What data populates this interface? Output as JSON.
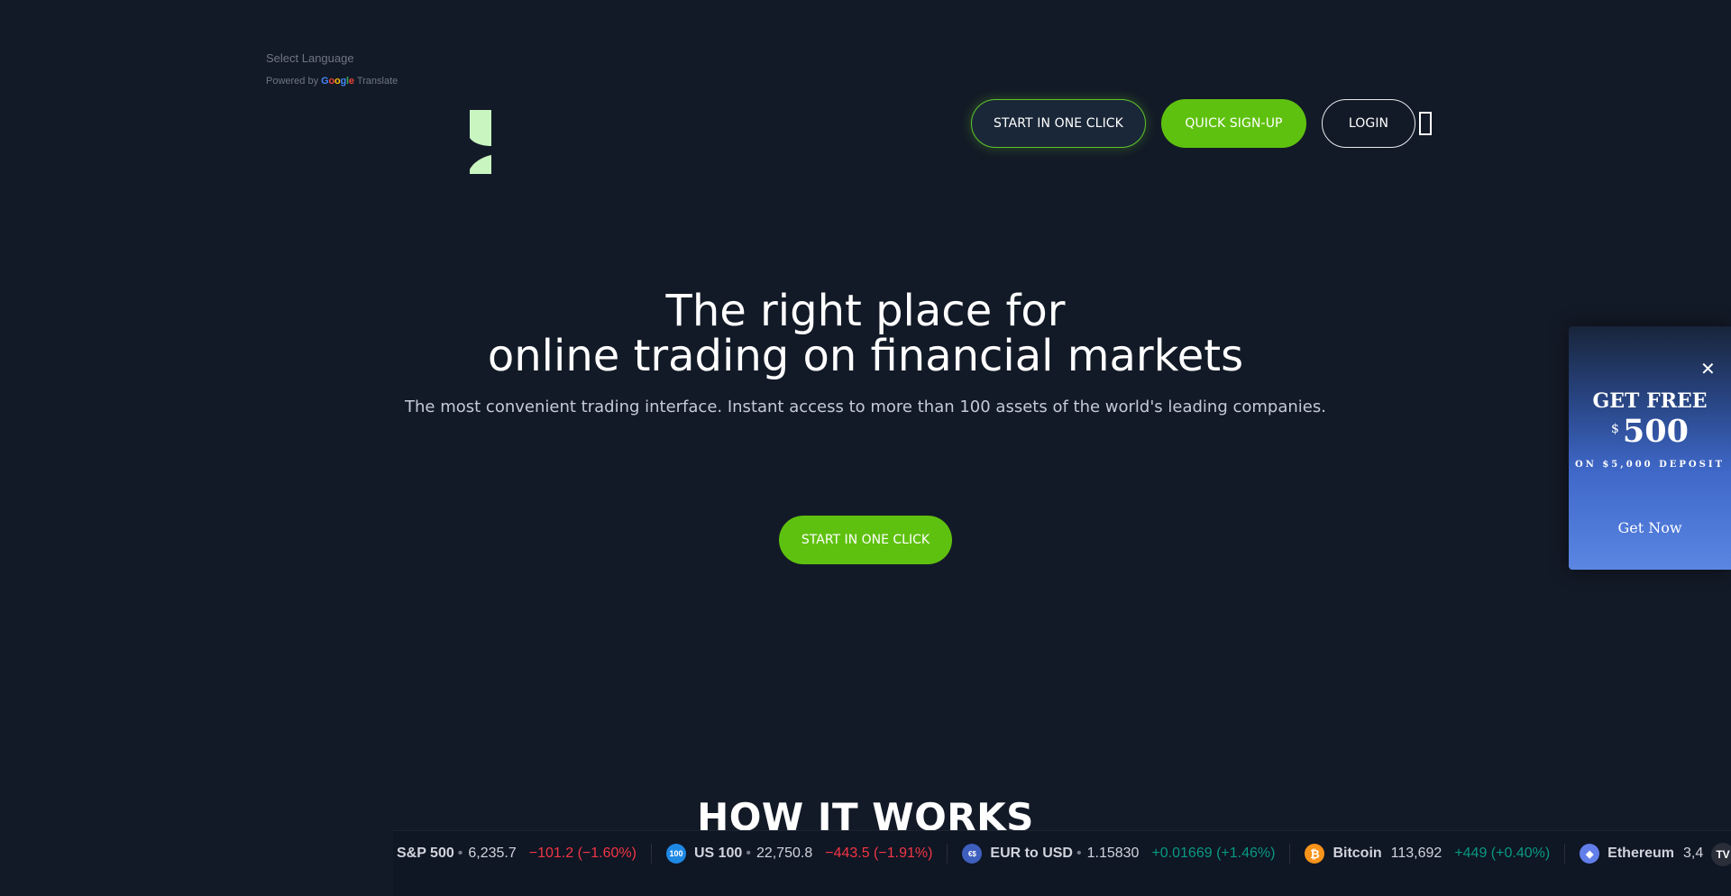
{
  "translate": {
    "select_language": "Select Language",
    "powered_by": "Powered by",
    "google_letters": [
      "G",
      "o",
      "o",
      "g",
      "l",
      "e"
    ],
    "translate_label": "Translate"
  },
  "header": {
    "start_button": "START IN ONE CLICK",
    "quick_signup_button": "QUICK SIGN-UP",
    "login_button": "LOGIN",
    "menu_icon": "hamburger-icon"
  },
  "hero": {
    "title_line1": "The right place for",
    "title_line2": "online trading on financial markets",
    "subtitle": "The most convenient trading interface. Instant access to more than 100 assets of the world's leading companies.",
    "cta_button": "START IN ONE CLICK"
  },
  "how_it_works": {
    "heading": "HOW IT WORKS"
  },
  "promo": {
    "close": "✕",
    "headline": "GET FREE",
    "currency": "$",
    "amount": "500",
    "condition": "ON $5,000 DEPOSIT",
    "cta": "Get Now"
  },
  "ticker": {
    "items": [
      {
        "name": "S&P 500",
        "dot": "•",
        "price": "6,235.7",
        "change": "−101.2 (−1.60%)",
        "direction": "negative",
        "icon": "",
        "icon_color": ""
      },
      {
        "name": "US 100",
        "dot": "•",
        "price": "22,750.8",
        "change": "−443.5 (−1.91%)",
        "direction": "negative",
        "icon": "100",
        "icon_color": "#1e88e5"
      },
      {
        "name": "EUR to USD",
        "dot": "•",
        "price": "1.15830",
        "change": "+0.01669 (+1.46%)",
        "direction": "positive",
        "icon": "€$",
        "icon_color": "#3f5fbf"
      },
      {
        "name": "Bitcoin",
        "dot": "",
        "price": "113,692",
        "change": "+449 (+0.40%)",
        "direction": "positive",
        "icon": "₿",
        "icon_color": "#f7931a"
      },
      {
        "name": "Ethereum",
        "dot": "",
        "price": "3,4",
        "change": "",
        "direction": "positive",
        "icon": "◆",
        "icon_color": "#627eea"
      }
    ],
    "brand_badge": "TV"
  },
  "colors": {
    "background": "#131a27",
    "accent_green": "#5fc10f",
    "negative": "#f23645",
    "positive": "#089981"
  }
}
